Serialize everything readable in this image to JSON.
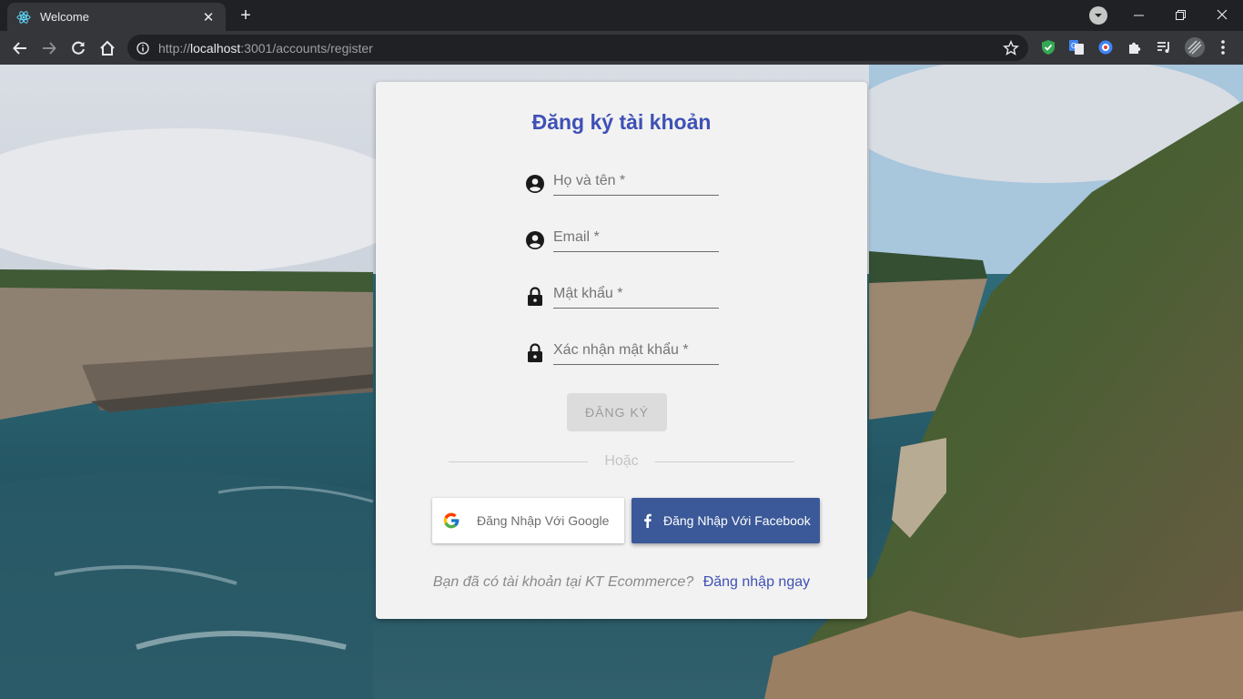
{
  "browser": {
    "tab_title": "Welcome",
    "url_prefix": "http://",
    "url_host": "localhost",
    "url_rest": ":3001/accounts/register",
    "icons": [
      "react-icon",
      "close-icon",
      "plus-icon",
      "tab-search-icon",
      "minimize-icon",
      "restore-icon",
      "window-close-icon",
      "back-icon",
      "forward-icon",
      "reload-icon",
      "home-icon",
      "info-icon",
      "star-icon",
      "shield-icon",
      "translate-icon",
      "extension-icon",
      "puzzle-icon",
      "media-icon",
      "avatar-icon",
      "menu-icon"
    ]
  },
  "register": {
    "title": "Đăng ký tài khoản",
    "fields": [
      {
        "placeholder": "Họ và tên *",
        "icon": "account-circle-icon"
      },
      {
        "placeholder": "Email *",
        "icon": "account-circle-icon"
      },
      {
        "placeholder": "Mật khẩu *",
        "icon": "lock-icon"
      },
      {
        "placeholder": "Xác nhận mật khẩu *",
        "icon": "lock-icon"
      }
    ],
    "submit_label": "ĐĂNG KÝ",
    "divider_text": "Hoặc",
    "google_label": "Đăng Nhập Với Google",
    "facebook_label": "Đăng Nhập Với Facebook",
    "footer_question": "Bạn đã có tài khoản tại KT Ecommerce?",
    "footer_link": "Đăng nhập ngay"
  },
  "colors": {
    "title": "#3f51b5",
    "facebook": "#3b5998",
    "card": "#f2f2f2",
    "chrome_dark": "#202124",
    "chrome_toolbar": "#35363a"
  }
}
